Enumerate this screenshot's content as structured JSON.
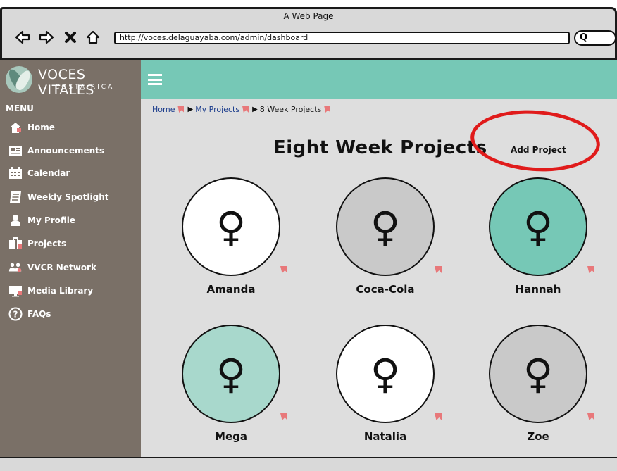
{
  "window": {
    "title": "A Web Page",
    "url": "http://voces.delaguayaba.com/admin/dashboard",
    "search_glyph": "Q"
  },
  "brand": {
    "name": "VOCES VITALES",
    "subtitle": "COSTA RICA",
    "header_color": "#76c8b6",
    "sidebar_color": "#7a7067"
  },
  "sidebar": {
    "menu_label": "MENU",
    "items": [
      {
        "label": "Home",
        "icon": "home-icon"
      },
      {
        "label": "Announcements",
        "icon": "newspaper-icon"
      },
      {
        "label": "Calendar",
        "icon": "calendar-icon"
      },
      {
        "label": "Weekly Spotlight",
        "icon": "notebook-icon"
      },
      {
        "label": "My Profile",
        "icon": "user-icon"
      },
      {
        "label": "Projects",
        "icon": "briefcase-icon"
      },
      {
        "label": "VVCR Network",
        "icon": "group-icon"
      },
      {
        "label": "Media Library",
        "icon": "monitor-icon"
      },
      {
        "label": "FAQs",
        "icon": "help-icon"
      }
    ]
  },
  "breadcrumb": {
    "home": "Home",
    "projects": "My Projects",
    "current": "8 Week Projects"
  },
  "main": {
    "title": "Eight Week Projects",
    "add_project": "Add Project"
  },
  "projects": [
    {
      "name": "Amanda",
      "color": "#ffffff",
      "icon": "female-icon"
    },
    {
      "name": "Coca-Cola",
      "color": "#c9c9c9",
      "icon": "female-icon"
    },
    {
      "name": "Hannah",
      "color": "#76c8b6",
      "icon": "female-icon"
    },
    {
      "name": "Mega",
      "color": "#a8d8cc",
      "icon": "female-icon"
    },
    {
      "name": "Natalia",
      "color": "#ffffff",
      "icon": "female-icon"
    },
    {
      "name": "Zoe",
      "color": "#c9c9c9",
      "icon": "female-icon"
    }
  ]
}
